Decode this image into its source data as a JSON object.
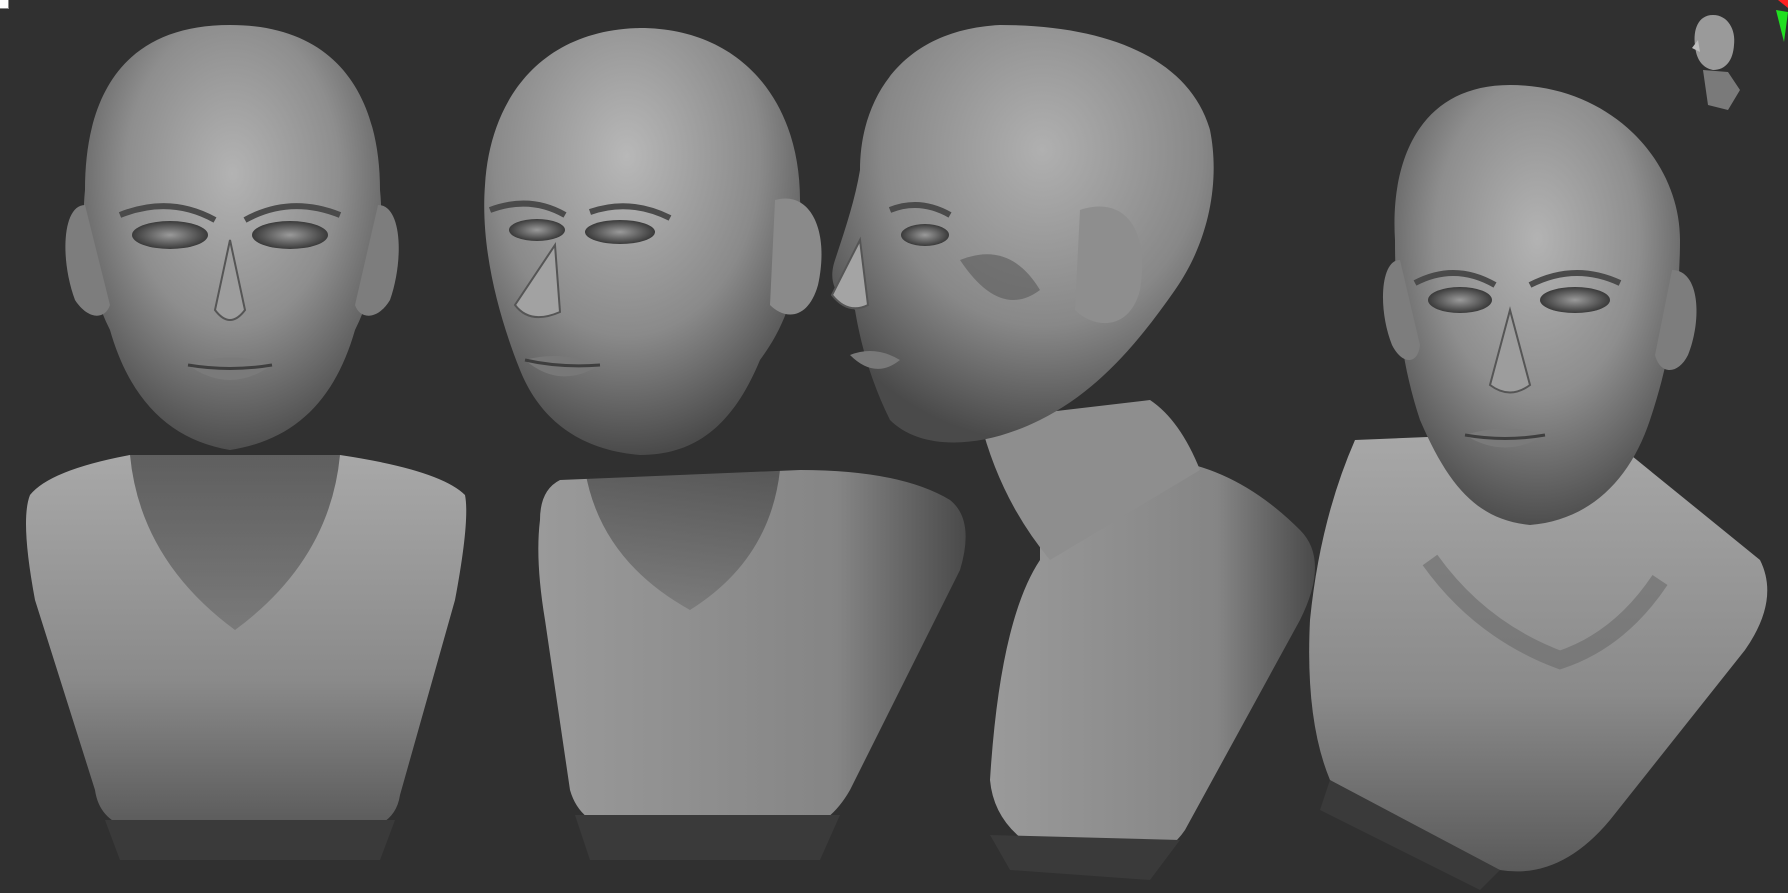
{
  "app": {
    "title": ""
  },
  "viewport": {
    "background": "#303030",
    "model_color": "#8c8c8c"
  },
  "models": [
    {
      "view": "front",
      "name": ""
    },
    {
      "view": "three-quarter",
      "name": ""
    },
    {
      "view": "profile",
      "name": ""
    },
    {
      "view": "three-quarter-low",
      "name": ""
    }
  ],
  "navigator": {
    "icon": "head-navigator-icon",
    "axis_colors": {
      "x": "#ff2020",
      "y": "#20ff20"
    }
  }
}
